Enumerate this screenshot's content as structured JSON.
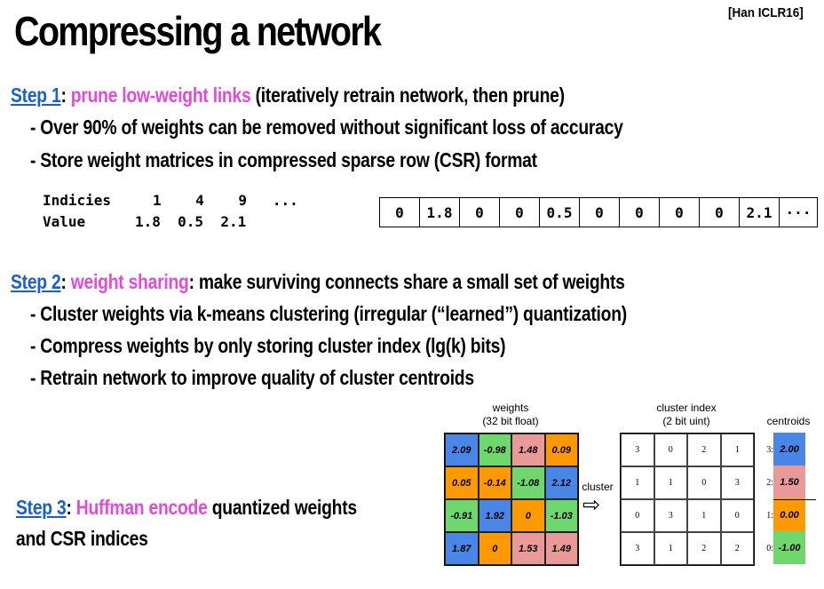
{
  "title": "Compressing a network",
  "citation": "[Han ICLR16]",
  "step1": {
    "step": "Step 1",
    "colon": ":",
    "highlight": "prune low-weight links",
    "rest": " (iteratively retrain network, then prune)",
    "bullets": [
      "-  Over 90% of weights can be removed without significant loss of accuracy",
      "-  Store weight matrices in compressed sparse row (CSR) format"
    ]
  },
  "csr": {
    "indices_label": "Indicies",
    "indices": "1    4    9   ...",
    "value_label": "Value",
    "values": "1.8  0.5  2.1",
    "array": [
      "0",
      "1.8",
      "0",
      "0",
      "0.5",
      "0",
      "0",
      "0",
      "0",
      "2.1",
      "···"
    ]
  },
  "step2": {
    "step": "Step 2",
    "colon": ":",
    "highlight": "weight sharing",
    "rest": ": make surviving connects share a small set of weights",
    "bullets": [
      "-  Cluster weights via k-means clustering (irregular (“learned”) quantization)",
      "-  Compress weights by only storing cluster index (lg(k) bits)",
      "-  Retrain network to improve quality of cluster centroids"
    ]
  },
  "step3": {
    "step": "Step 3",
    "colon": ": ",
    "highlight": "Huffman encode",
    "rest": " quantized weights",
    "line2": "and CSR indices"
  },
  "figure": {
    "weights_title": "weights",
    "weights_sub": "(32 bit float)",
    "weights": [
      [
        "2.09",
        "-0.98",
        "1.48",
        "0.09"
      ],
      [
        "0.05",
        "-0.14",
        "-1.08",
        "2.12"
      ],
      [
        "-0.91",
        "1.92",
        "0",
        "-1.03"
      ],
      [
        "1.87",
        "0",
        "1.53",
        "1.49"
      ]
    ],
    "weight_clusters": [
      [
        3,
        0,
        2,
        1
      ],
      [
        1,
        1,
        0,
        3
      ],
      [
        0,
        3,
        1,
        0
      ],
      [
        3,
        1,
        2,
        2
      ]
    ],
    "cluster_label": "cluster",
    "arrow": "⇨",
    "index_title": "cluster index",
    "index_sub": "(2 bit uint)",
    "centroids_title": "centroids",
    "centroid_labels": [
      "3:",
      "2:",
      "1:",
      "0:"
    ],
    "centroids": [
      "2.00",
      "1.50",
      "0.00",
      "-1.00"
    ],
    "colors": {
      "3": "#4a86e8",
      "2": "#ea9999",
      "1": "#ff9900",
      "0": "#6ed86e"
    }
  }
}
